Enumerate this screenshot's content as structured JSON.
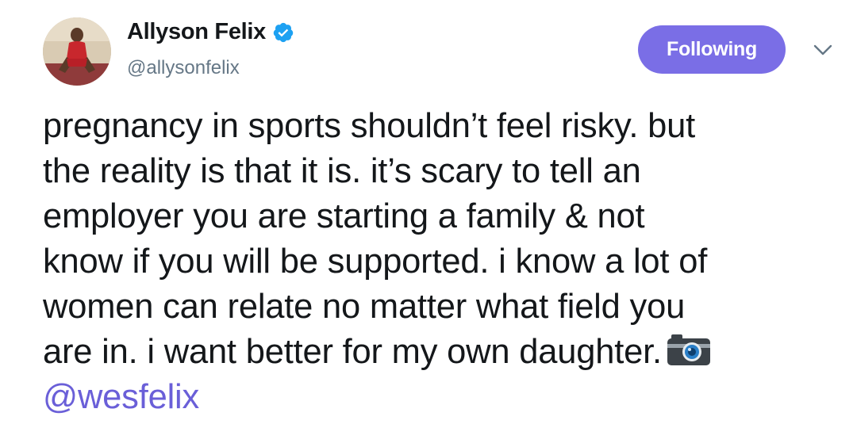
{
  "user": {
    "display_name": "Allyson Felix",
    "handle": "@allysonfelix",
    "verified": true,
    "avatar_icon": "avatar-photo"
  },
  "actions": {
    "follow_label": "Following",
    "menu_icon": "chevron-down-icon"
  },
  "tweet": {
    "lines": [
      "pregnancy in sports shouldn’t feel risky. but",
      "the reality is that it is. it’s scary to tell an",
      "employer you are starting a family & not",
      "know if you will be supported. i know a lot of",
      "women can relate no matter what field you",
      "are in. i want better for my own daughter."
    ],
    "trailing_icon": "camera-icon",
    "mention": "@wesfelix"
  },
  "colors": {
    "accent": "#7a6ee6",
    "mention": "#6a5fd8",
    "verified_badge": "#1da1f2",
    "handle_gray": "#657786",
    "text": "#14171a"
  }
}
